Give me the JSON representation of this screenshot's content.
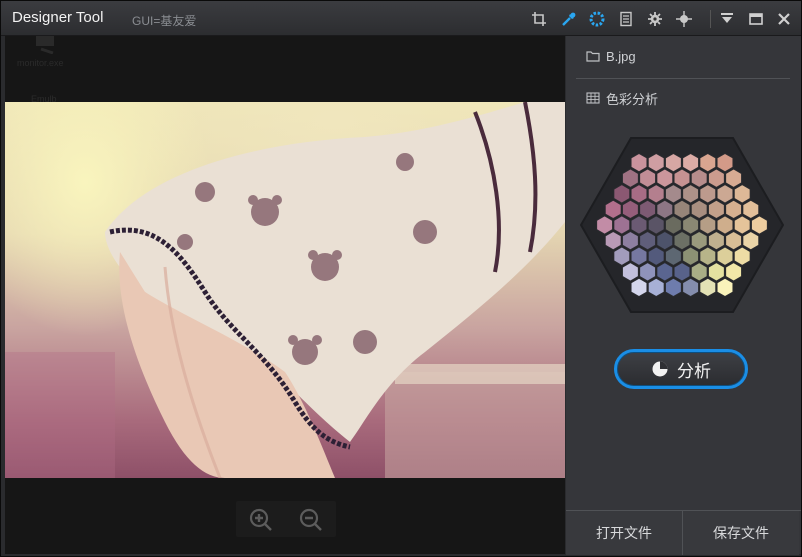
{
  "window": {
    "title": "Designer Tool",
    "subtitle": "GUI=基友爱"
  },
  "toolbar": {
    "items": [
      {
        "icon": "crop-icon"
      },
      {
        "icon": "eyedropper-icon",
        "active": true
      },
      {
        "icon": "loading-ring-icon",
        "active": true
      },
      {
        "icon": "document-icon"
      },
      {
        "icon": "gear-icon"
      },
      {
        "icon": "move-icon"
      }
    ],
    "window_controls": [
      "dropdown-icon",
      "maximize-icon",
      "close-icon"
    ]
  },
  "canvas": {
    "background_label": "monitor.exe",
    "background_label2": "Emulb",
    "zoom_controls": [
      "zoom-in-icon",
      "zoom-out-icon"
    ]
  },
  "panel": {
    "file_name": "B.jpg",
    "section_title": "色彩分析",
    "analyze_label": "分析",
    "open_label": "打开文件",
    "save_label": "保存文件",
    "accent_color": "#1a8ee6",
    "palette_rows": [
      [
        "#c9939d",
        "#cf9ea2",
        "#d7a7a4",
        "#dcaca6",
        "#d9a590",
        "#d39a88"
      ],
      [
        "#a07283",
        "#c18d96",
        "#cc969c",
        "#c69292",
        "#b78d8c",
        "#cc9c8e",
        "#d7ab93"
      ],
      [
        "#8b5872",
        "#a76c85",
        "#b47f8e",
        "#a48a8c",
        "#ae9289",
        "#bd9a8d",
        "#cca893",
        "#ddb897"
      ],
      [
        "#b26f8c",
        "#955e7b",
        "#7d5a73",
        "#8d7685",
        "#978579",
        "#a88e80",
        "#c3a08a",
        "#d6b090",
        "#e2bf9a"
      ],
      [
        "#c28ca6",
        "#9e7293",
        "#6b5a73",
        "#5a5466",
        "#6a6b5f",
        "#8a8773",
        "#b59e86",
        "#cfae8c",
        "#e5c49a",
        "#eecd9f"
      ],
      [
        "#b99ab6",
        "#8d7fa0",
        "#5f5e7a",
        "#4d536a",
        "#6c7065",
        "#9a9a7d",
        "#c0b08f",
        "#d9be96",
        "#ead4a7"
      ],
      [
        "#a29cbc",
        "#7678a0",
        "#535a7c",
        "#5d6772",
        "#8c9174",
        "#b7b489",
        "#dccf9a",
        "#eedda5"
      ],
      [
        "#c2c0dc",
        "#8f93bb",
        "#5a6590",
        "#58628a",
        "#a9ae86",
        "#e4e1a0",
        "#f2e7a8"
      ],
      [
        "#d4d6ec",
        "#a7b0d6",
        "#6e7cad",
        "#848dad",
        "#e3e1b5",
        "#faf3bb"
      ]
    ]
  }
}
